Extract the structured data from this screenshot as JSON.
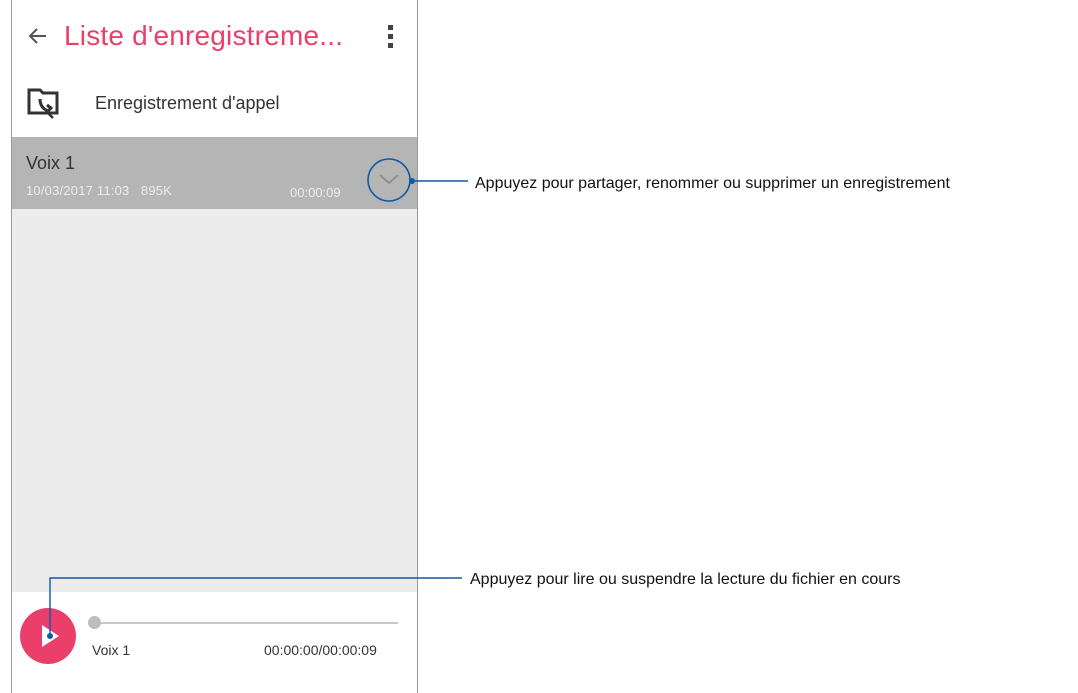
{
  "app": {
    "title": "Liste d'enregistreme...",
    "accent": "#ea3f6b",
    "back_icon": "arrow-left-icon",
    "menu_icon": "more-vert-icon"
  },
  "call_recording": {
    "label": "Enregistrement d'appel",
    "icon": "call-recording-folder-icon"
  },
  "recordings": [
    {
      "name": "Voix 1",
      "date": "10/03/2017 11:03",
      "size": "895K",
      "duration": "00:00:09",
      "expand_icon": "chevron-down-icon"
    }
  ],
  "player": {
    "track_name": "Voix 1",
    "time": "00:00:00/00:00:09",
    "progress": 0,
    "play_icon": "play-icon"
  },
  "annotations": {
    "expand": "Appuyez pour partager, renommer ou supprimer un enregistrement",
    "play": "Appuyez pour lire ou suspendre la lecture du fichier en cours"
  }
}
